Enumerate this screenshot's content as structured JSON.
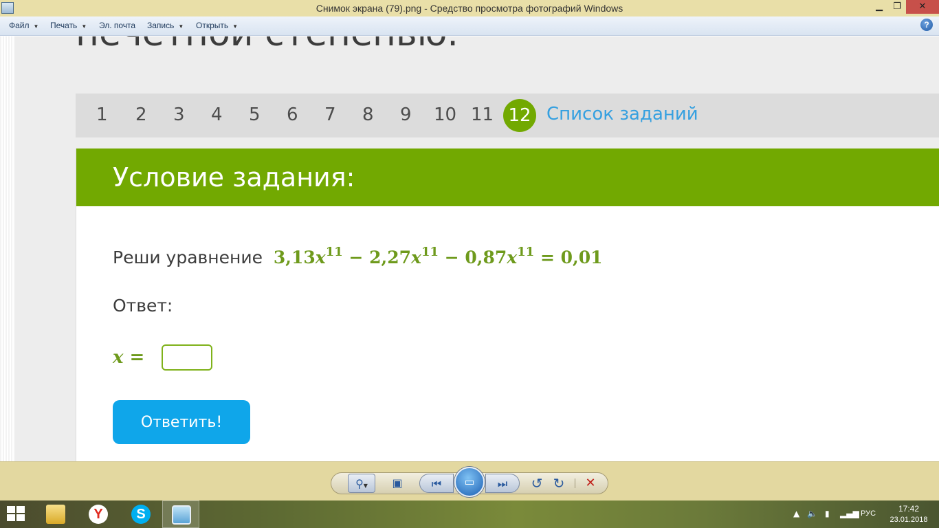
{
  "window": {
    "title": "Снимок экрана (79).png - Средство просмотра фотографий Windows",
    "min": "▁",
    "max": "❐",
    "close": "✕"
  },
  "menu": {
    "items": [
      {
        "label": "Файл",
        "has_arrow": true
      },
      {
        "label": "Печать",
        "has_arrow": true
      },
      {
        "label": "Эл. почта",
        "has_arrow": false
      },
      {
        "label": "Запись",
        "has_arrow": true
      },
      {
        "label": "Открыть",
        "has_arrow": true
      }
    ],
    "help": "?"
  },
  "page": {
    "heading_partial": "нечетной степенью.",
    "nav": {
      "numbers": [
        "1",
        "2",
        "3",
        "4",
        "5",
        "6",
        "7",
        "8",
        "9",
        "10",
        "11"
      ],
      "current": "12",
      "list_link": "Список заданий"
    },
    "card": {
      "title": "Условие задания:",
      "question_label": "Реши уравнение",
      "equation": {
        "c1": "3,13",
        "c2": "2,27",
        "c3": "0,87",
        "var": "x",
        "exp": "11",
        "rhs": "0,01",
        "minus": "−",
        "eq": "="
      },
      "answer_label": "Ответ:",
      "x_eq": "x =",
      "answer_value": "",
      "submit_label": "Ответить!"
    }
  },
  "toolbar": {
    "zoom_icon": "⚲",
    "fit_icon": "▣",
    "prev_icon": "⏮",
    "slideshow_icon": "▭",
    "next_icon": "⏭",
    "rotate_left_icon": "↺",
    "rotate_right_icon": "↻",
    "delete_icon": "✕"
  },
  "taskbar": {
    "yandex_letter": "Y",
    "skype_letter": "S",
    "lang": "РУС",
    "time": "17:42",
    "date": "23.01.2018"
  },
  "colors": {
    "green": "#72a901",
    "blue_button": "#0fa6ea",
    "link_blue": "#35a0e0",
    "math_green": "#6e9a1c"
  }
}
